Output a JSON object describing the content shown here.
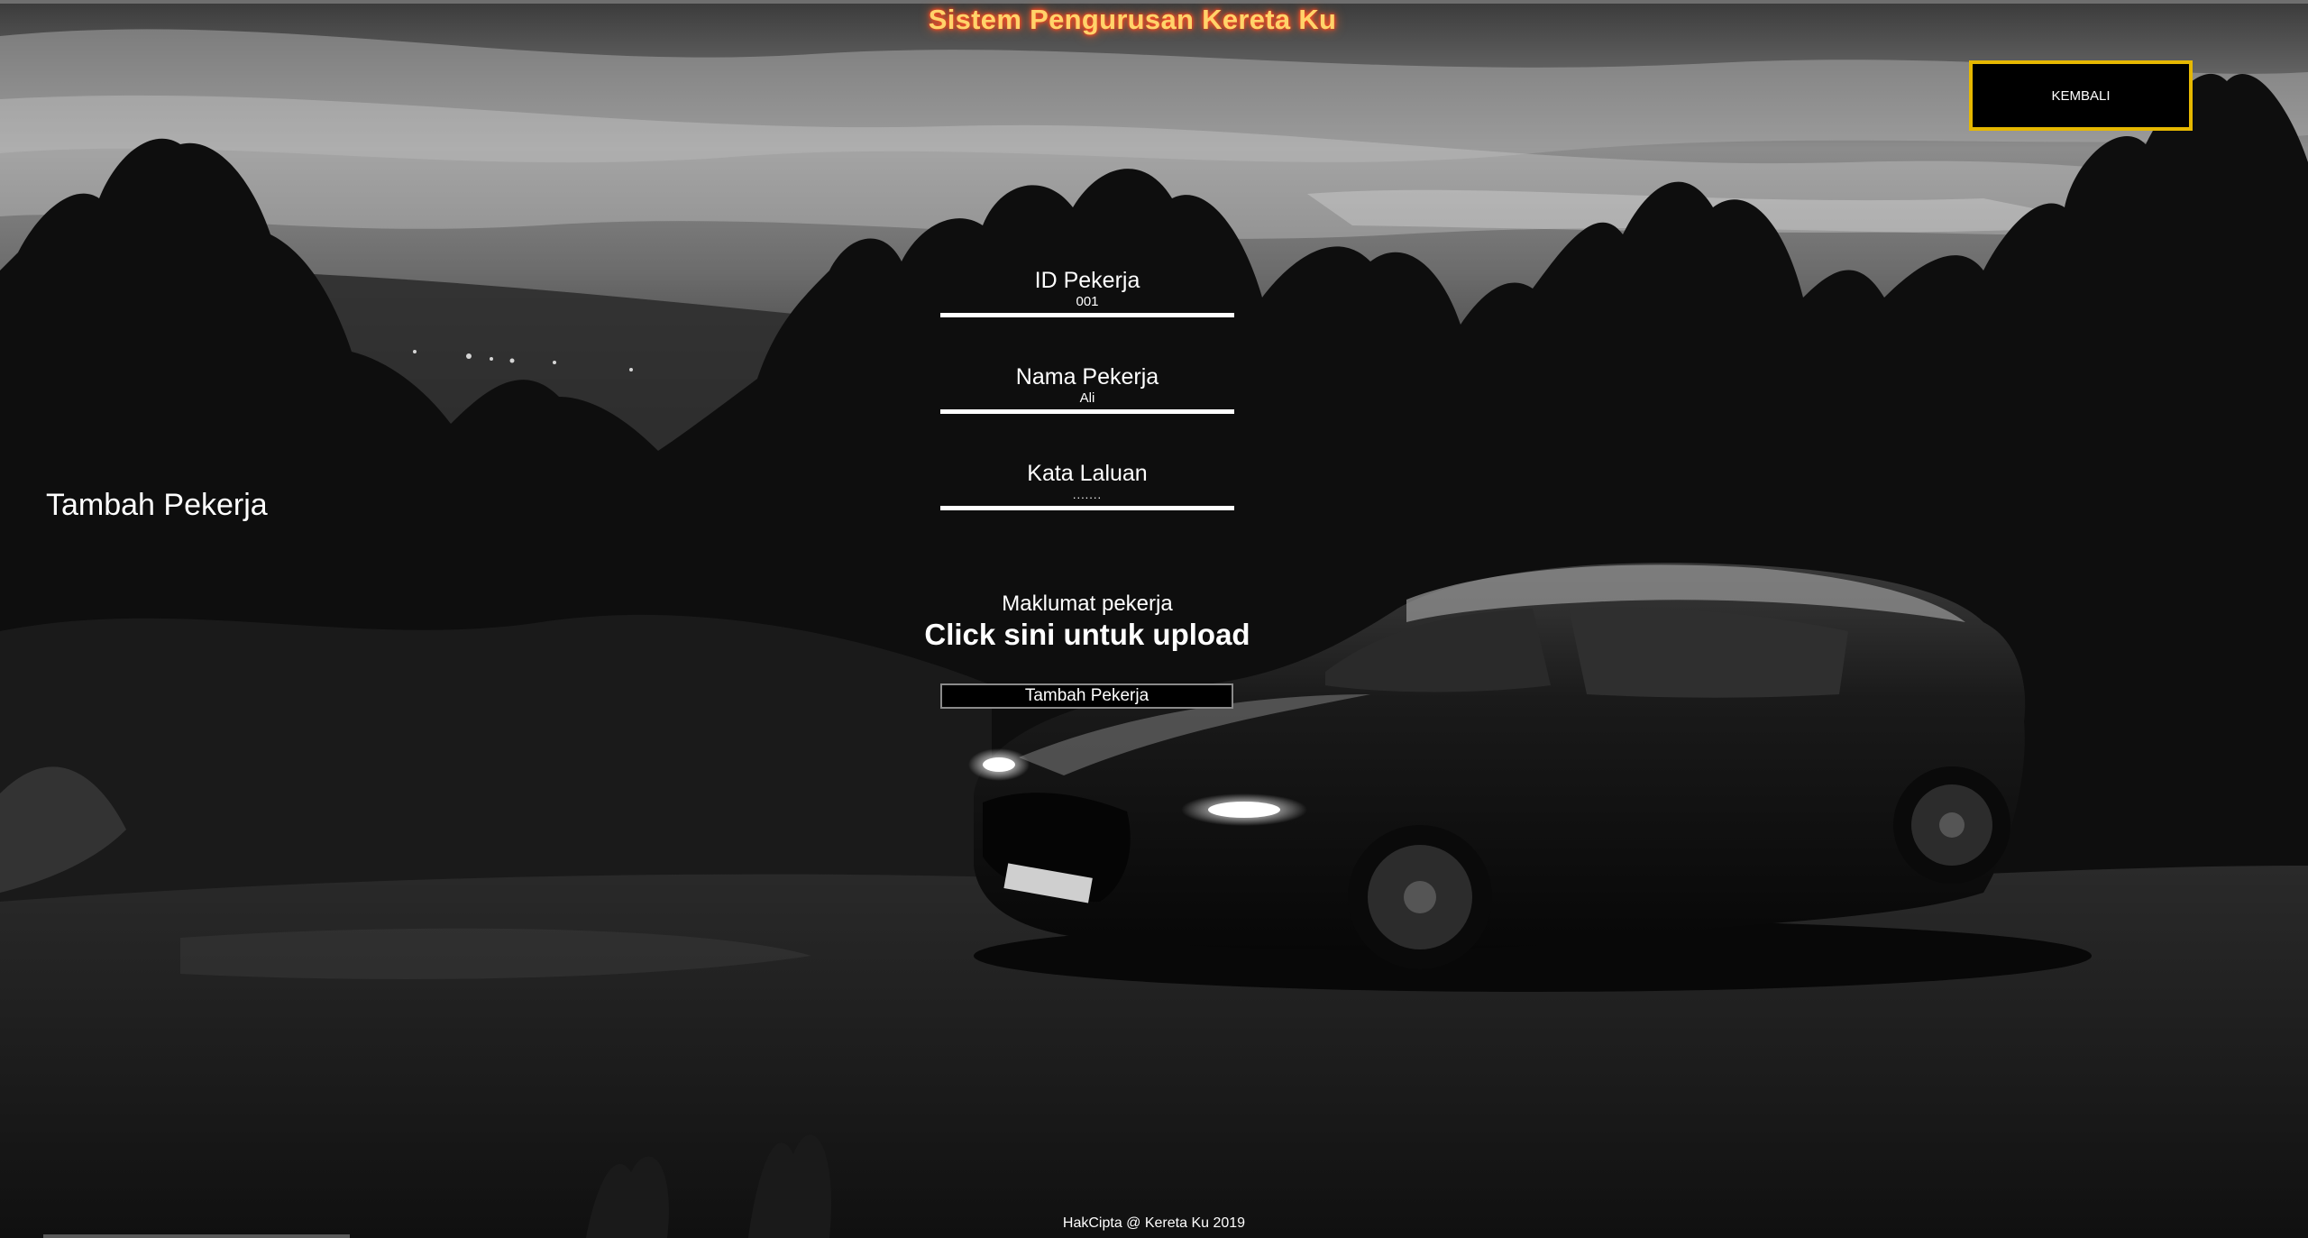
{
  "header": {
    "title": "Sistem Pengurusan Kereta Ku",
    "title_color": "#ffd36a",
    "back_button_label": "KEMBALI",
    "back_button_border": "#e6b800"
  },
  "sidebar": {
    "heading": "Tambah Pekerja"
  },
  "form": {
    "fields": [
      {
        "label": "ID Pekerja",
        "value": "001"
      },
      {
        "label": "Nama Pekerja",
        "value": "Ali"
      },
      {
        "label": "Kata Laluan",
        "value": "......."
      }
    ],
    "upload_label": "Maklumat pekerja",
    "upload_link": "Click sini untuk upload",
    "submit_label": "Tambah Pekerja"
  },
  "footer": {
    "text": "HakCipta @ Kereta Ku 2019"
  }
}
